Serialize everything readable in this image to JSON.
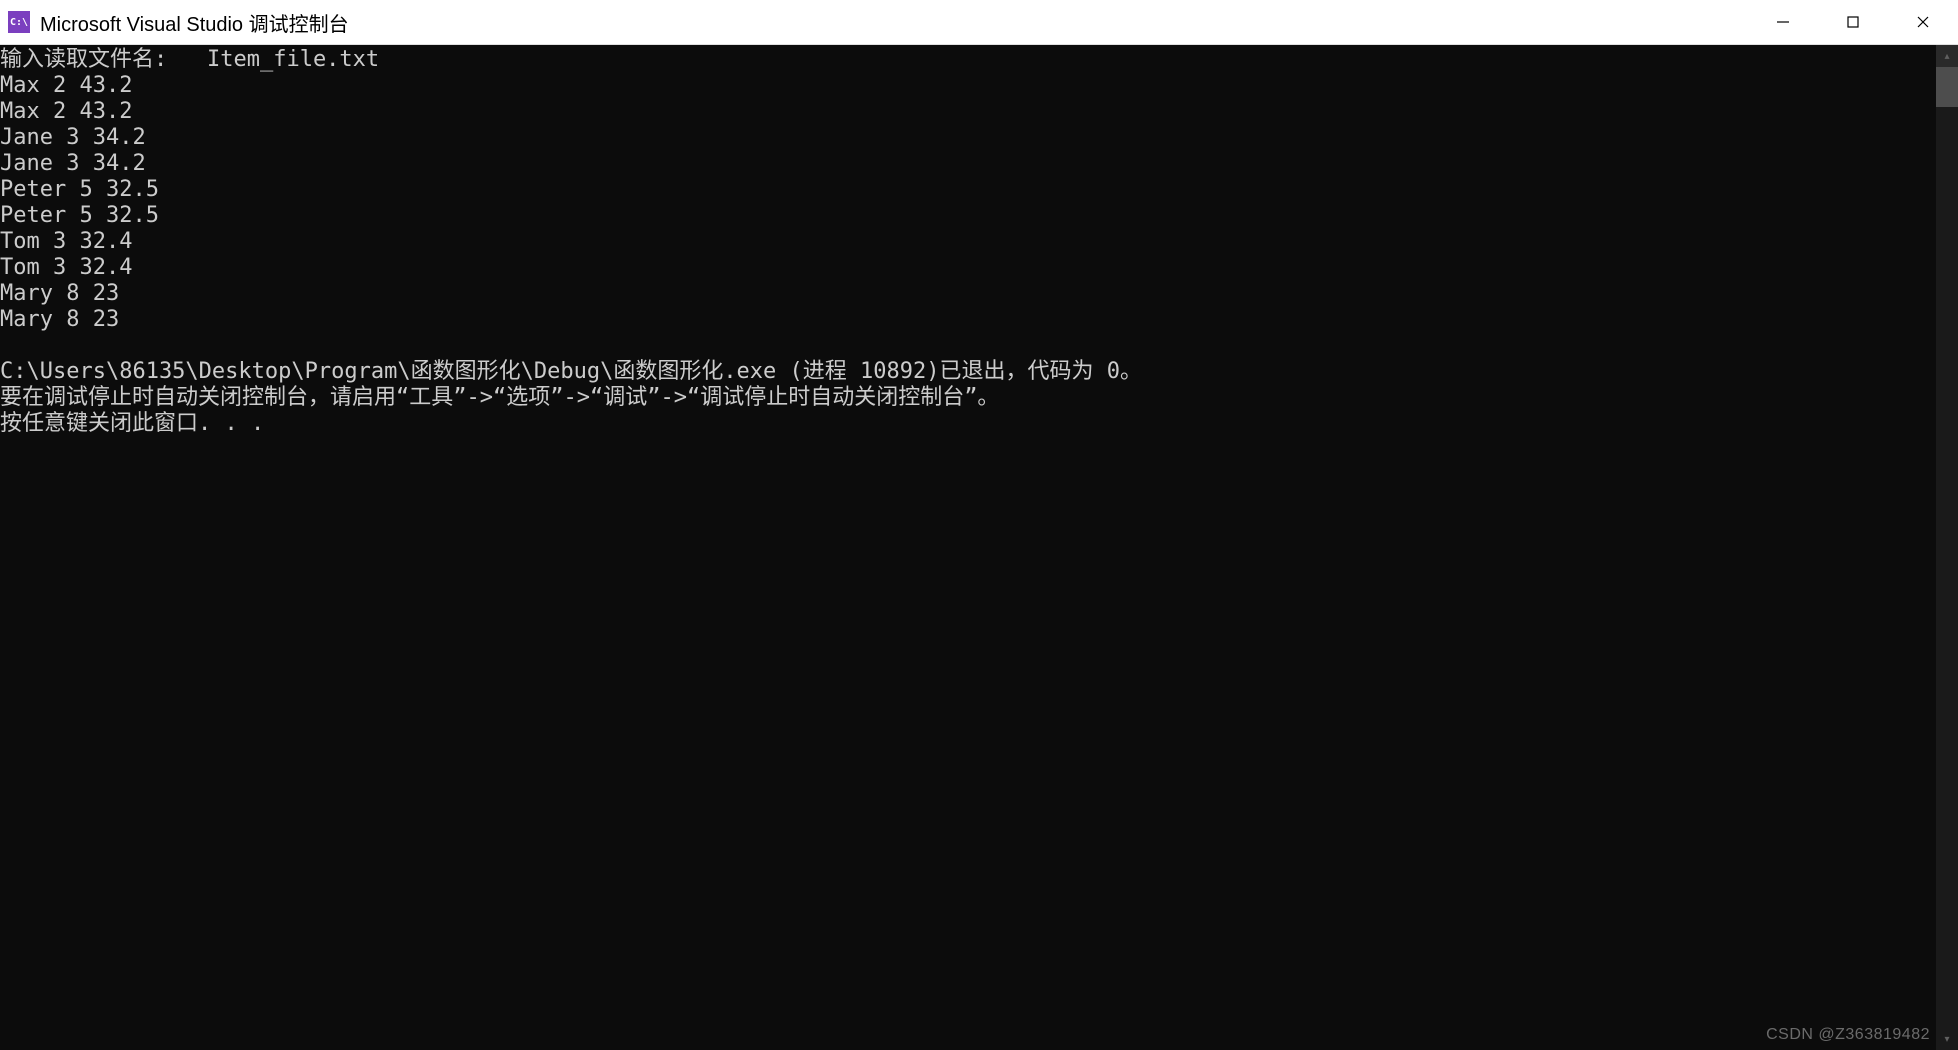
{
  "window": {
    "icon_label": "C:\\",
    "title": "Microsoft Visual Studio 调试控制台"
  },
  "console": {
    "prompt_label": "输入读取文件名:",
    "input_filename": "Item_file.txt",
    "records": [
      {
        "name": "Max",
        "a": 2,
        "b": "43.2"
      },
      {
        "name": "Max",
        "a": 2,
        "b": "43.2"
      },
      {
        "name": "Jane",
        "a": 3,
        "b": "34.2"
      },
      {
        "name": "Jane",
        "a": 3,
        "b": "34.2"
      },
      {
        "name": "Peter",
        "a": 5,
        "b": "32.5"
      },
      {
        "name": "Peter",
        "a": 5,
        "b": "32.5"
      },
      {
        "name": "Tom",
        "a": 3,
        "b": "32.4"
      },
      {
        "name": "Tom",
        "a": 3,
        "b": "32.4"
      },
      {
        "name": "Mary",
        "a": 8,
        "b": "23"
      },
      {
        "name": "Mary",
        "a": 8,
        "b": "23"
      }
    ],
    "exit_line": "C:\\Users\\86135\\Desktop\\Program\\函数图形化\\Debug\\函数图形化.exe (进程 10892)已退出，代码为 0。",
    "hint_line": "要在调试停止时自动关闭控制台，请启用“工具”->“选项”->“调试”->“调试停止时自动关闭控制台”。",
    "close_line": "按任意键关闭此窗口. . ."
  },
  "watermark": "CSDN @Z363819482"
}
